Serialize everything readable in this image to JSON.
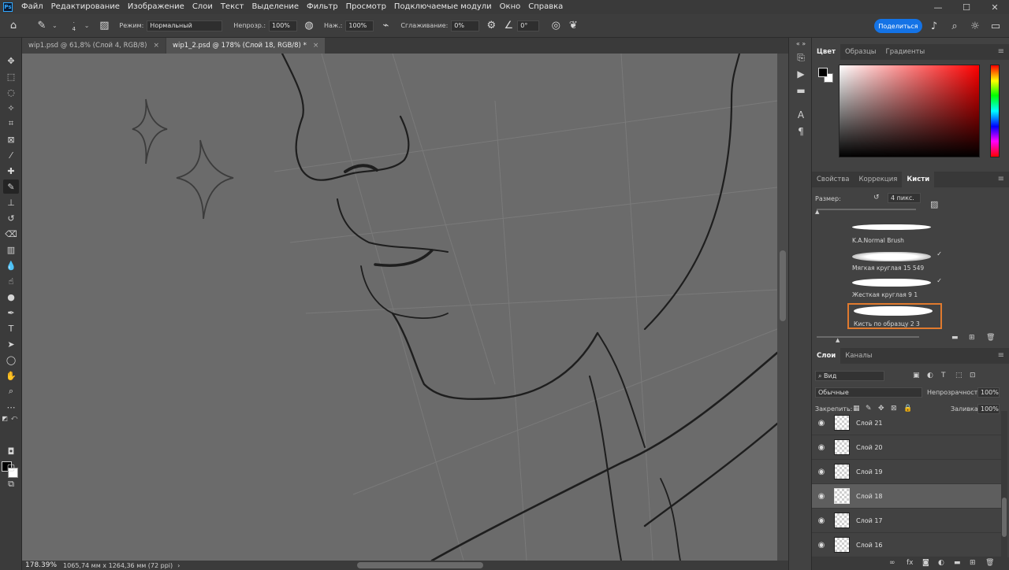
{
  "app": {
    "logo": "Ps"
  },
  "menu": [
    "Файл",
    "Редактирование",
    "Изображение",
    "Слои",
    "Текст",
    "Выделение",
    "Фильтр",
    "Просмотр",
    "Подключаемые модули",
    "Окно",
    "Справка"
  ],
  "options": {
    "brush_size": "4",
    "mode_label": "Режим:",
    "mode_value": "Нормальный",
    "opacity_label": "Непрозр.:",
    "opacity_value": "100%",
    "flow_label": "Наж.:",
    "flow_value": "100%",
    "smoothing_label": "Сглаживание:",
    "smoothing_value": "0%",
    "angle_value": "0°",
    "share_label": "Поделиться"
  },
  "tabs": [
    {
      "label": "wip1.psd @ 61,8% (Слой 4, RGB/8)",
      "close": "×"
    },
    {
      "label": "wip1_2.psd @ 178% (Слой 18, RGB/8) *",
      "close": "×"
    }
  ],
  "status": {
    "zoom": "178.39%",
    "info": "1065,74 мм x 1264,36 мм (72 ppi)",
    "arrow": "›"
  },
  "color_panel": {
    "tabs": [
      "Цвет",
      "Образцы",
      "Градиенты"
    ],
    "fg": "#000000",
    "bg": "#ffffff"
  },
  "brush_panel": {
    "tabs": [
      "Свойства",
      "Коррекция",
      "Кисти"
    ],
    "size_label": "Размер:",
    "size_value": "4 пикс.",
    "brushes": [
      {
        "name": "K.A.Normal Brush",
        "checked": false
      },
      {
        "name": "Мягкая круглая 15 549",
        "checked": true
      },
      {
        "name": "Жесткая круглая 9 1",
        "checked": true
      },
      {
        "name": "Кисть по образцу 2 3",
        "checked": false,
        "selected": true
      }
    ]
  },
  "layers_panel": {
    "tabs": [
      "Слои",
      "Каналы"
    ],
    "filter_label": "Вид",
    "blend_mode": "Обычные",
    "opacity_label": "Непрозрачность:",
    "opacity_value": "100%",
    "lock_label": "Закрепить:",
    "fill_label": "Заливка:",
    "fill_value": "100%",
    "layers": [
      {
        "name": "Слой 21",
        "selected": false
      },
      {
        "name": "Слой 20",
        "selected": false
      },
      {
        "name": "Слой 19",
        "selected": false
      },
      {
        "name": "Слой 18",
        "selected": true
      },
      {
        "name": "Слой 17",
        "selected": false
      },
      {
        "name": "Слой 16",
        "selected": false
      }
    ],
    "footer_icons": [
      "link-icon",
      "fx-icon",
      "mask-icon",
      "adjustment-icon",
      "folder-icon",
      "new-layer-icon",
      "trash-icon"
    ]
  },
  "colors": {
    "accent": "#1473e6",
    "selection_outline": "#e07a2e"
  }
}
